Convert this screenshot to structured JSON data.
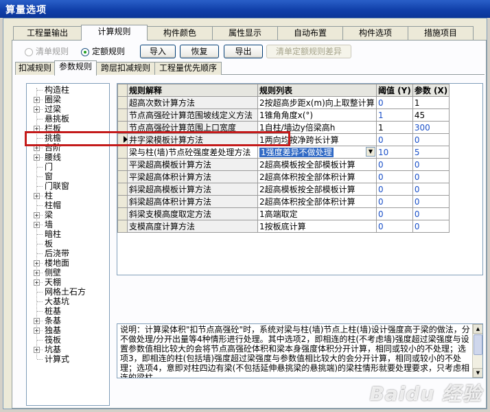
{
  "window": {
    "title": "算量选项"
  },
  "main_tabs": [
    "工程量输出",
    "计算规则",
    "构件颜色",
    "属性显示",
    "自动布置",
    "构件选项",
    "措施项目"
  ],
  "mode": {
    "option_list": "清单规则",
    "option_quota": "定额规则"
  },
  "toolbar": {
    "import": "导入",
    "restore": "恢复",
    "export": "导出",
    "diff": "清单定额规则差异"
  },
  "sub_tabs": [
    "扣减规则",
    "参数规则",
    "跨层扣减规则",
    "工程量优先顺序"
  ],
  "tree": [
    {
      "label": "构造柱",
      "plus": false
    },
    {
      "label": "圈梁",
      "plus": true
    },
    {
      "label": "过梁",
      "plus": true
    },
    {
      "label": "悬挑板",
      "plus": false
    },
    {
      "label": "栏板",
      "plus": true
    },
    {
      "label": "挑檐",
      "plus": false
    },
    {
      "label": "台阶",
      "plus": true
    },
    {
      "label": "腰线",
      "plus": true
    },
    {
      "label": "门",
      "plus": false
    },
    {
      "label": "窗",
      "plus": false
    },
    {
      "label": "门联窗",
      "plus": false
    },
    {
      "label": "柱",
      "plus": true
    },
    {
      "label": "柱帽",
      "plus": false
    },
    {
      "label": "梁",
      "plus": true
    },
    {
      "label": "墙",
      "plus": true
    },
    {
      "label": "暗柱",
      "plus": false
    },
    {
      "label": "板",
      "plus": false
    },
    {
      "label": "后浇带",
      "plus": false
    },
    {
      "label": "楼地面",
      "plus": true
    },
    {
      "label": "侧壁",
      "plus": true
    },
    {
      "label": "天棚",
      "plus": true
    },
    {
      "label": "网格土石方",
      "plus": false
    },
    {
      "label": "大基坑",
      "plus": false
    },
    {
      "label": "桩基",
      "plus": false
    },
    {
      "label": "条基",
      "plus": true
    },
    {
      "label": "独基",
      "plus": true
    },
    {
      "label": "筏板",
      "plus": false
    },
    {
      "label": "坑基",
      "plus": true
    },
    {
      "label": "计算式",
      "plus": false
    }
  ],
  "grid": {
    "headers": {
      "rule": "规则解释",
      "list": "规则列表",
      "threshold": "阈值 (Y)",
      "param": "参数 (X)"
    },
    "rows": [
      {
        "rule": "超高次数计算方法",
        "list": "2按超高步距x(m)向上取整计算",
        "threshold": "0",
        "param": "1"
      },
      {
        "rule": "节点高强砼计算范围坡线定义方法",
        "list": "1锥角角度x(°)",
        "threshold": "1",
        "param": "45"
      },
      {
        "rule": "节点高强砼计算范围上口宽度",
        "list": "1自柱/墙边y倍梁高h",
        "threshold": "1",
        "param": "300"
      },
      {
        "rule": "井字梁模板计算方法",
        "list": "1两向均按净跨长计算",
        "threshold": "0",
        "param": "0"
      },
      {
        "rule": "梁与柱(墙)节点砼强度差处理方法",
        "list": "1强度差异不做处理",
        "threshold": "10",
        "param": "5"
      },
      {
        "rule": "平梁超高模板计算方法",
        "list": "2超高模板按全部模板计算",
        "threshold": "0",
        "param": "0"
      },
      {
        "rule": "平梁超高体积计算方法",
        "list": "2超高体积按全部体积计算",
        "threshold": "0",
        "param": "0"
      },
      {
        "rule": "斜梁超高模板计算方法",
        "list": "2超高模板按全部模板计算",
        "threshold": "0",
        "param": "0"
      },
      {
        "rule": "斜梁超高体积计算方法",
        "list": "2超高体积按全部体积计算",
        "threshold": "0",
        "param": "0"
      },
      {
        "rule": "斜梁支模高度取定方法",
        "list": "1高端取定",
        "threshold": "0",
        "param": "0"
      },
      {
        "rule": "支模高度计算方法",
        "list": "1按板底计算",
        "threshold": "0",
        "param": "0"
      }
    ]
  },
  "description": "说明：计算梁体积\"扣节点高强砼\"时，系统对梁与柱(墙)节点上柱(墙)设计强度高于梁的做法，分不做处理/分开出量等4种情形进行处理。其中选项2，即相连的柱(不考虑墙)强度超过梁强度与设置参数值相比较大的会将节点高强砼体积和梁本身强度体积分开计算，相同或较小的不处理；选项3，即相连的柱(包括墙)强度超过梁强度与参数值相比较大的会分开计算，相同或较小的不处理；选项4，意即对柱四边有梁(不包括延伸悬挑梁的悬挑端)的梁柱情形就要处理要求，只考虑相连的梁柱",
  "watermark": "Baidu 经验"
}
